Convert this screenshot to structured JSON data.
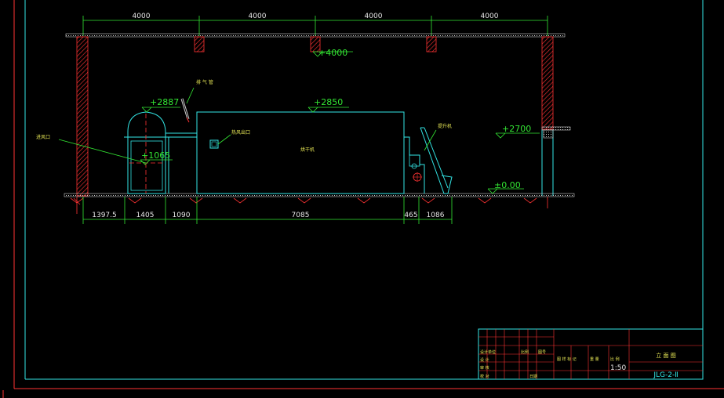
{
  "colors": {
    "background": "#000000",
    "frame": "#ff3333",
    "border": "#33e6e6",
    "dimension": "#33e633",
    "structure": "#e6e6e6",
    "equipment": "#33e6e6",
    "fixture": "#ff3333",
    "note": "#e6e655"
  },
  "top_dimensions": [
    "4000",
    "4000",
    "4000",
    "4000"
  ],
  "levels": {
    "ceiling": "+4000",
    "window": "+2887",
    "dryer_top": "+2850",
    "platform": "+2700",
    "door_center": "+1065",
    "floor": "±0.00"
  },
  "bottom_dimensions": [
    "1397.5",
    "1405",
    "1090",
    "7085",
    "465",
    "1086"
  ],
  "annotations": {
    "left_inlet": "进风口",
    "vent_label": "排 气 管",
    "hot_air_outlet": "热风出口",
    "dryer_body": "烘干机",
    "conveyor_label": "提升机"
  },
  "title_block": {
    "drawing_title": "立 面 图",
    "scale": "1:50",
    "drawing_number": "JLG-2-Ⅱ",
    "header_cells": [
      "设计单位",
      "比例",
      "图号"
    ],
    "row_cells": [
      "设 计",
      "审 核",
      "校 对",
      "日期"
    ],
    "mid_cells": [
      "图 样 标 记",
      "重 量",
      "比 例"
    ]
  }
}
